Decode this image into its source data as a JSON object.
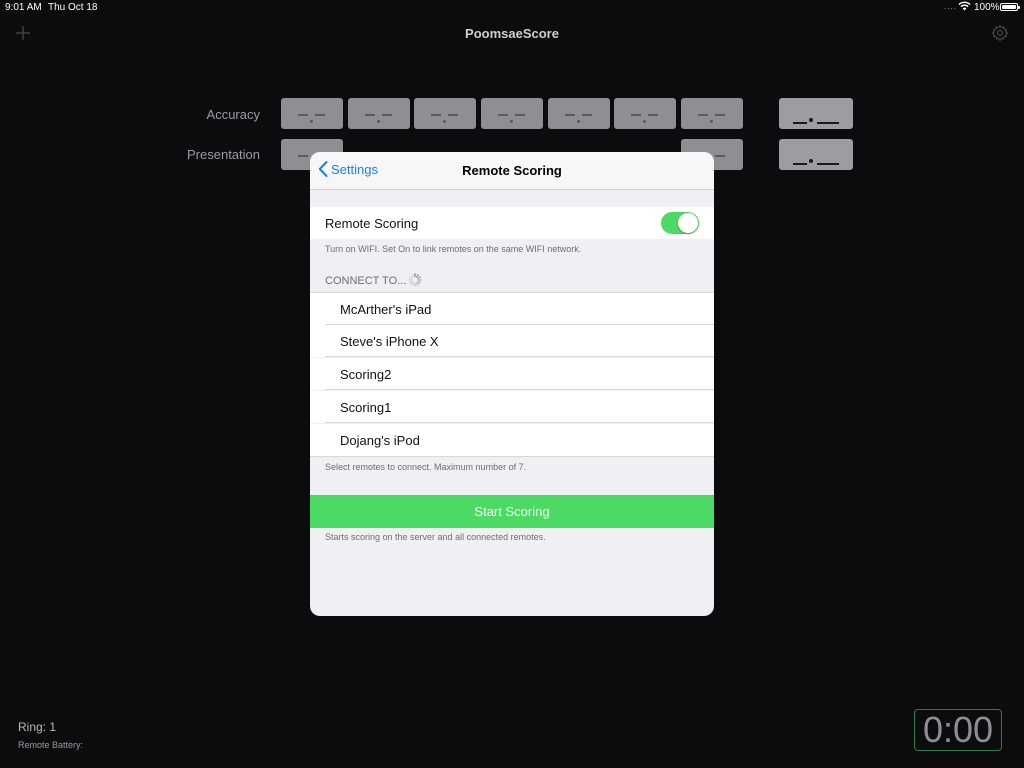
{
  "status_bar": {
    "time": "9:01 AM",
    "date": "Thu Oct 18",
    "signal": "....",
    "battery_percent": "100%"
  },
  "nav": {
    "title": "PoomsaeScore",
    "add_icon": "plus-icon",
    "settings_icon": "gear-icon"
  },
  "score_rows": {
    "accuracy_label": "Accuracy",
    "presentation_label": "Presentation"
  },
  "bottom": {
    "ring_label": "Ring:  1",
    "remote_battery_label": "Remote Battery:",
    "timer": "0:00"
  },
  "modal": {
    "back_label": "Settings",
    "title": "Remote Scoring",
    "remote_scoring_label": "Remote Scoring",
    "remote_scoring_on": true,
    "remote_scoring_footnote": "Turn on WIFI.  Set On to link remotes on the same WIFI network.",
    "connect_header": "CONNECT TO...",
    "devices": [
      "McArther's iPad",
      "Steve's iPhone X",
      "Scoring2",
      "Scoring1",
      "Dojang's iPod"
    ],
    "devices_footnote": "Select remotes to connect.  Maximum number of 7.",
    "start_label": "Start Scoring",
    "start_footnote": "Starts scoring on the server and all connected remotes."
  },
  "colors": {
    "accent_blue": "#1a7ef5",
    "green": "#4cd964",
    "background": "#0c0c0e"
  }
}
